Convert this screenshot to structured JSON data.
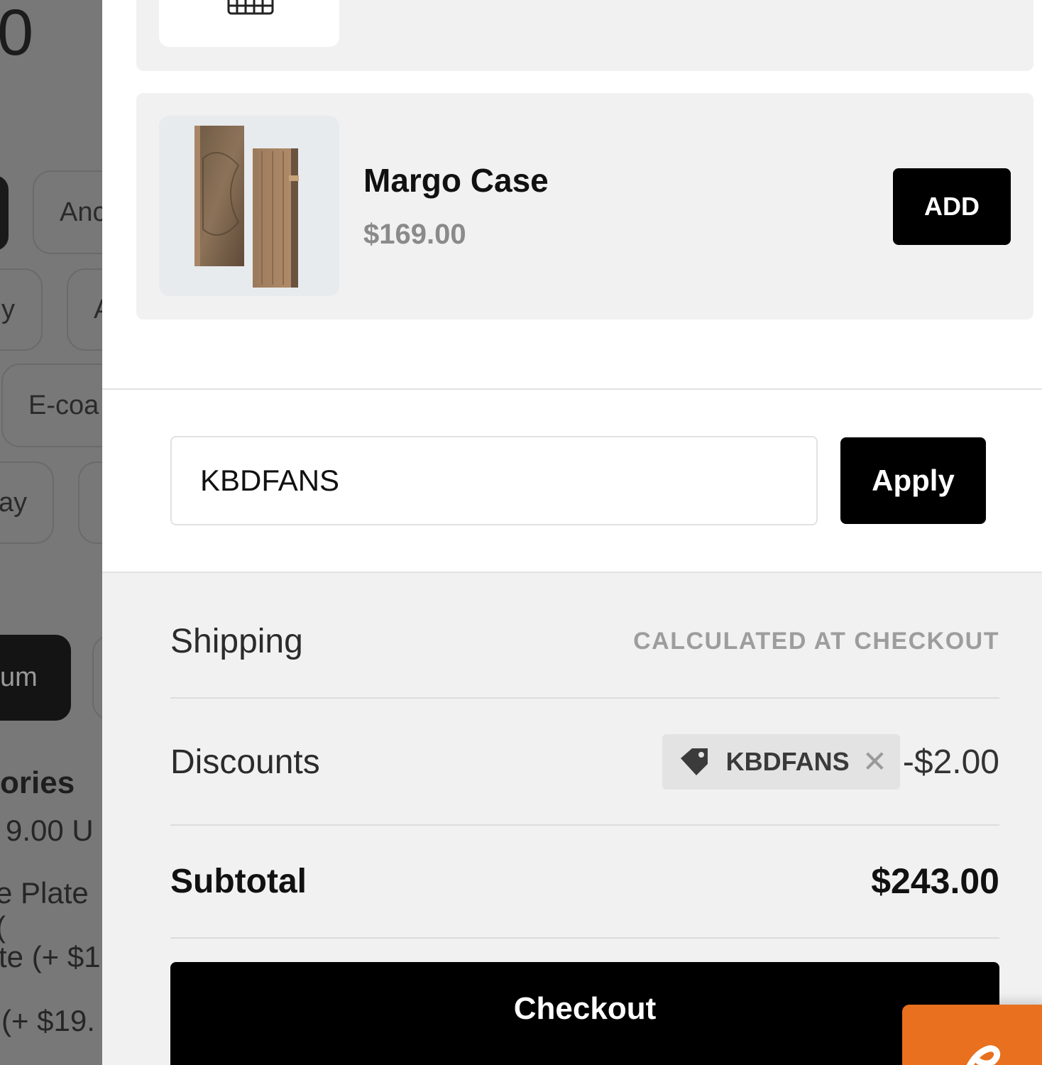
{
  "background_page": {
    "big_digit": "0",
    "option_pills": [
      "Anc",
      "y",
      "A",
      "E-coa",
      "ay"
    ],
    "selected_option": "um",
    "section_title": "ories",
    "lines": [
      "9.00 U",
      "e Plate (",
      "te (+ $1",
      "(+ $19."
    ]
  },
  "cart": {
    "products": [
      {
        "name": "",
        "price": ""
      },
      {
        "name": "Margo Case",
        "price": "$169.00",
        "add_label": "ADD"
      }
    ],
    "discount_form": {
      "code_value": "KBDFANS",
      "apply_label": "Apply"
    },
    "totals": {
      "shipping_label": "Shipping",
      "shipping_value": "CALCULATED AT CHECKOUT",
      "discounts_label": "Discounts",
      "discount_code": "KBDFANS",
      "discount_amount": "-$2.00",
      "subtotal_label": "Subtotal",
      "subtotal_value": "$243.00"
    },
    "checkout_label": "Checkout"
  },
  "icons": {
    "tag": "tag-icon",
    "remove": "close-icon",
    "chat": "chat-icon"
  },
  "colors": {
    "button": "#000000",
    "card_bg": "#f1f1f1",
    "chat_widget": "#e8701e",
    "muted_text": "#9d9d9d"
  }
}
